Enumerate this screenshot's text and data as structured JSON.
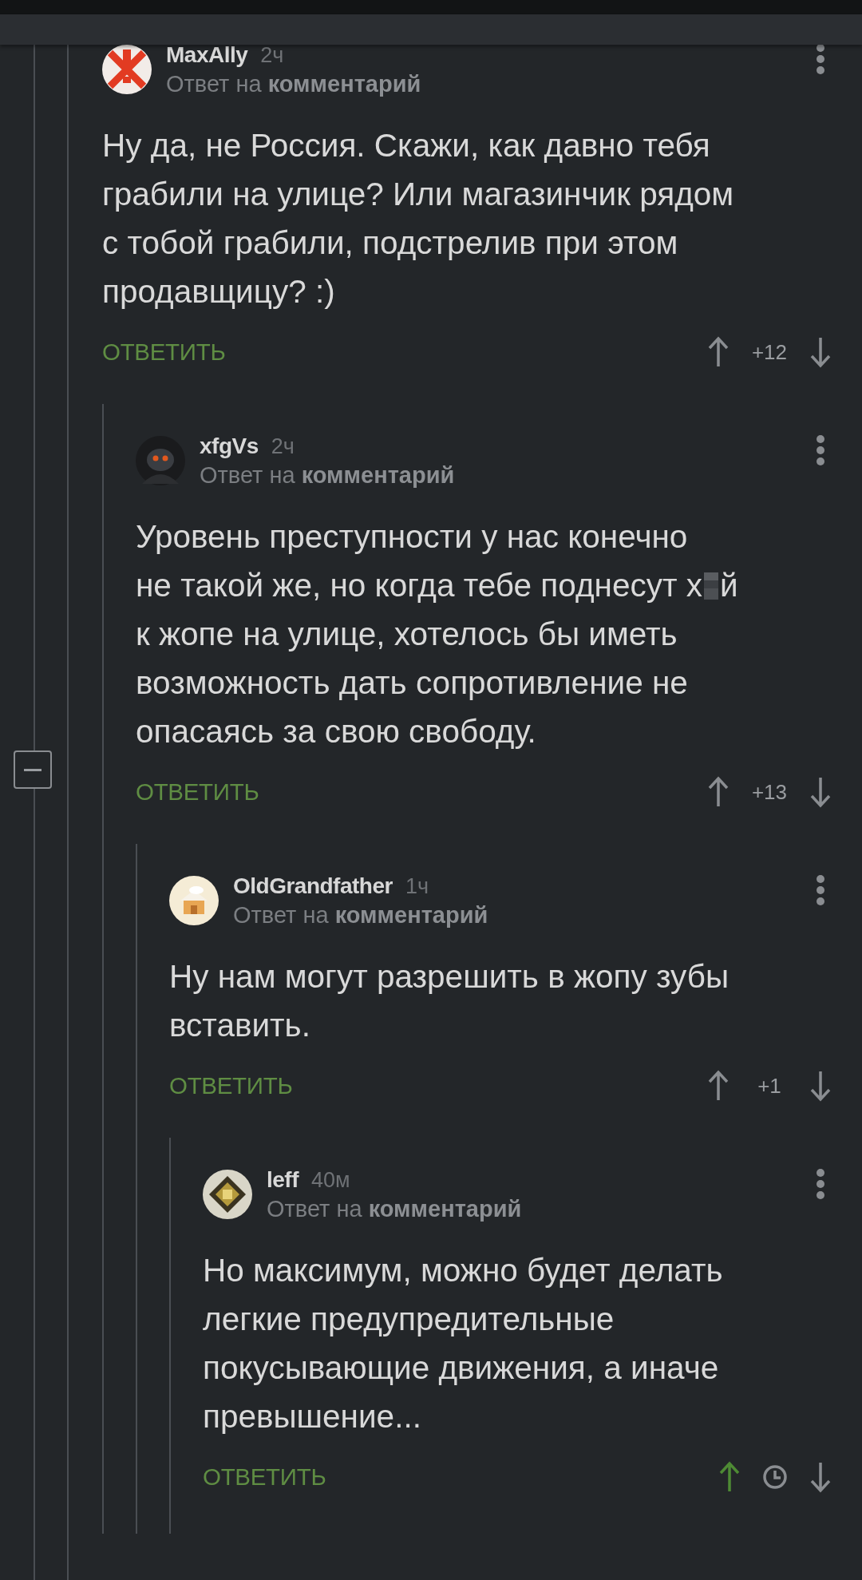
{
  "collapse_button": {
    "expanded": true
  },
  "comments": [
    {
      "username": "MaxAlly",
      "time": "2ч",
      "reply_to": "Ответ на **комментарий**",
      "body": [
        [
          "Ну да, не Россия. Скажи, как давно тебя"
        ],
        [
          "грабили на улице? Или магазинчик рядом"
        ],
        [
          "с тобой грабили, подстрелив при этом"
        ],
        [
          "продавщицу? :)"
        ]
      ],
      "reply_label": "ОТВЕТИТЬ",
      "upvoted": false,
      "rating": {
        "kind": "score",
        "text": "+12"
      },
      "children": [
        {
          "username": "xfgVs",
          "time": "2ч",
          "reply_to": "Ответ на **комментарий**",
          "body": [
            [
              "Уровень преступности у нас конечно"
            ],
            [
              "не такой же, но когда тебе поднесут х",
              {
                "kind": "censor"
              },
              "й"
            ],
            [
              "к жопе на улице, хотелось бы иметь"
            ],
            [
              "возможность дать сопротивление не"
            ],
            [
              "опасаясь за свою свободу."
            ]
          ],
          "reply_label": "ОТВЕТИТЬ",
          "upvoted": false,
          "rating": {
            "kind": "score",
            "text": "+13"
          },
          "children": [
            {
              "username": "OldGrandfather",
              "time": "1ч",
              "reply_to": "Ответ на **комментарий**",
              "body": [
                [
                  "Ну нам могут разрешить в жопу зубы"
                ],
                [
                  "вставить."
                ]
              ],
              "reply_label": "ОТВЕТИТЬ",
              "upvoted": false,
              "rating": {
                "kind": "score",
                "text": "+1"
              },
              "children": [
                {
                  "username": "leff",
                  "time": "40м",
                  "reply_to": "Ответ на **комментарий**",
                  "body": [
                    [
                      "Но максимум, можно будет делать"
                    ],
                    [
                      "легкие предупредительные"
                    ],
                    [
                      "покусывающие движения, а иначе"
                    ],
                    [
                      "превышение..."
                    ]
                  ],
                  "reply_label": "ОТВЕТИТЬ",
                  "upvoted": true,
                  "rating": {
                    "kind": "hidden"
                  }
                }
              ]
            }
          ]
        }
      ]
    }
  ]
}
